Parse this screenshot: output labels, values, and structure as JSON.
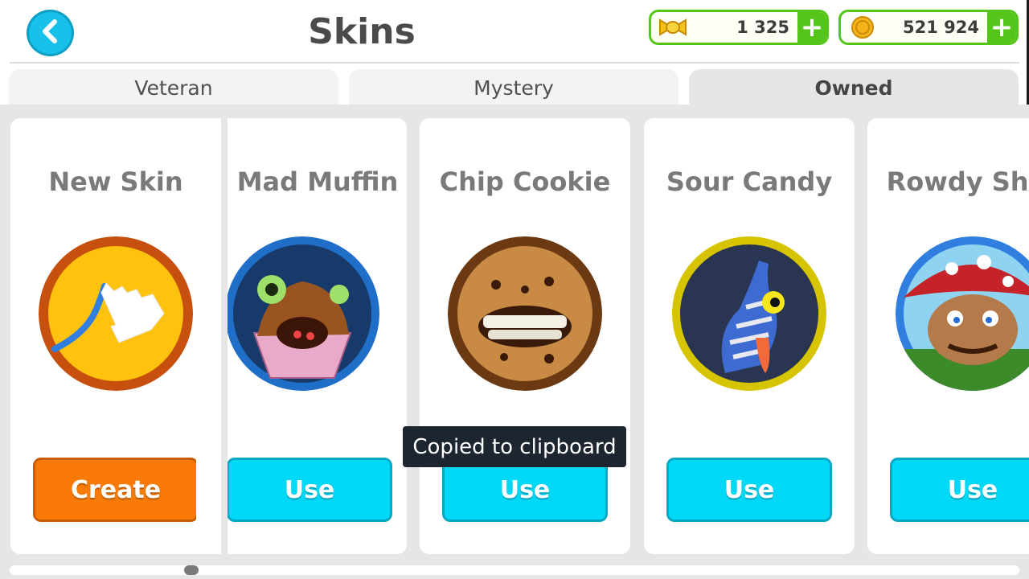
{
  "header": {
    "title": "Skins",
    "back_icon": "chevron-left-icon"
  },
  "currencies": [
    {
      "name": "candy",
      "value": "1 325",
      "icon": "candy-icon",
      "plus_label": "+"
    },
    {
      "name": "coins",
      "value": "521 924",
      "icon": "coin-icon",
      "plus_label": "+"
    }
  ],
  "tabs": [
    {
      "label": "Veteran",
      "active": false
    },
    {
      "label": "Mystery",
      "active": false
    },
    {
      "label": "Owned",
      "active": true
    }
  ],
  "cards": [
    {
      "title": "New Skin",
      "button": "Create",
      "ring_color": "#c8500e",
      "icon": "hand-draw-icon"
    },
    {
      "title": "Mad Muffin",
      "button": "Use",
      "ring_color": "#1f6fc9",
      "icon": "muffin-avatar"
    },
    {
      "title": "Chip Cookie",
      "button": "Use",
      "ring_color": "#6b3a12",
      "icon": "cookie-avatar"
    },
    {
      "title": "Sour Candy",
      "button": "Use",
      "ring_color": "#d6c400",
      "icon": "candy-avatar"
    },
    {
      "title": "Rowdy Shro",
      "button": "Use",
      "ring_color": "#2f7ee0",
      "icon": "mushroom-avatar"
    }
  ],
  "toast": {
    "text": "Copied to clipboard"
  },
  "scrollbar": {
    "position": 0.17
  },
  "colors": {
    "accent_cyan": "#00d8f8",
    "create_orange": "#f97a06",
    "currency_green": "#55c51a"
  }
}
